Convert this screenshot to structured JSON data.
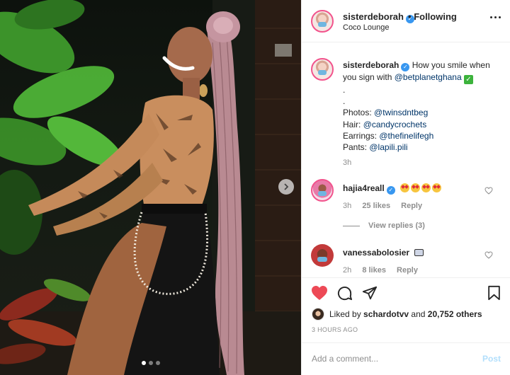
{
  "post": {
    "username": "sisterdeborah",
    "follow_sep": "•",
    "follow_status": "Following",
    "location": "Coco Lounge",
    "caption": {
      "username": "sisterdeborah",
      "text_lead": "How you smile when you sign with",
      "mention_brand": "@betplanetghana",
      "check_glyph": "✓",
      "dot1": ".",
      "dot2": ".",
      "photos_label": "Photos:",
      "photos_mention": "@twinsdntbeg",
      "hair_label": "Hair:",
      "hair_mention": "@candycrochets",
      "earrings_label": "Earrings:",
      "earrings_mention": "@thefinelifegh",
      "pants_label": "Pants:",
      "pants_mention": "@lapili.pili",
      "time": "3h"
    },
    "comments": [
      {
        "username": "hajia4reall",
        "emoji_count": 4,
        "time": "3h",
        "likes": "25 likes",
        "reply": "Reply",
        "view_replies": "View replies (3)"
      },
      {
        "username": "vanessabolosier",
        "time": "2h",
        "likes": "8 likes",
        "reply": "Reply"
      }
    ],
    "liked_by_prefix": "Liked by",
    "liked_by_user": "schardotvv",
    "liked_by_and": "and",
    "liked_by_others": "20,752 others",
    "time_ago": "3 HOURS AGO",
    "add_comment_placeholder": "Add a comment...",
    "post_button": "Post",
    "carousel": {
      "slides": 3,
      "active": 0
    }
  },
  "colors": {
    "like_red": "#ed4956",
    "link": "#003569",
    "verified": "#3897f0",
    "post_disabled": "#b2dffc"
  },
  "icons": [
    "verified-badge-icon",
    "more-options-icon",
    "next-arrow-icon",
    "heart-filled-icon",
    "comment-icon",
    "share-icon",
    "bookmark-icon",
    "heart-outline-icon"
  ]
}
